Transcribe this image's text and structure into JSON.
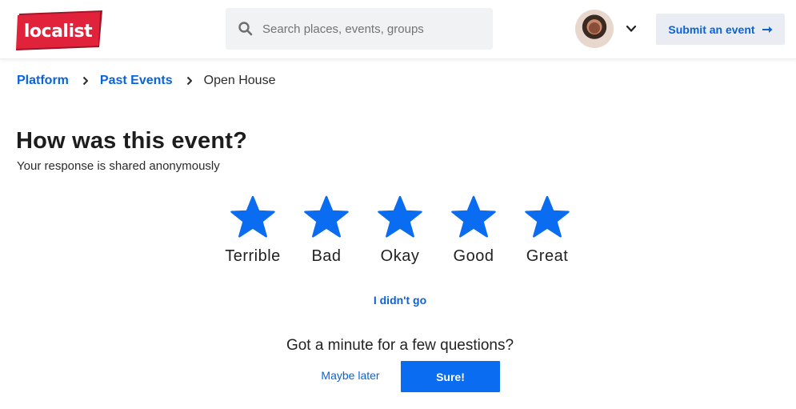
{
  "header": {
    "logo_text": "localist",
    "search": {
      "placeholder": "Search places, events, groups",
      "value": ""
    },
    "submit_label": "Submit an event"
  },
  "breadcrumb": {
    "items": [
      {
        "label": "Platform"
      },
      {
        "label": "Past Events"
      }
    ],
    "current": "Open House"
  },
  "feedback": {
    "title": "How was this event?",
    "subtitle": "Your response is shared anonymously",
    "ratings": [
      {
        "label": "Terrible"
      },
      {
        "label": "Bad"
      },
      {
        "label": "Okay"
      },
      {
        "label": "Good"
      },
      {
        "label": "Great"
      }
    ],
    "didnt_go": "I didn't go",
    "question": "Got a minute for a few questions?",
    "maybe_later": "Maybe later",
    "sure": "Sure!"
  },
  "colors": {
    "accent": "#0b63d8",
    "star": "#0a6cf0",
    "logo_red": "#e0223b",
    "logo_shadow": "#a01528",
    "button_bg": "#e9edf3"
  },
  "icons": [
    "search-icon",
    "chevron-down-icon",
    "arrow-right-icon",
    "chevron-right-icon",
    "star-icon"
  ]
}
